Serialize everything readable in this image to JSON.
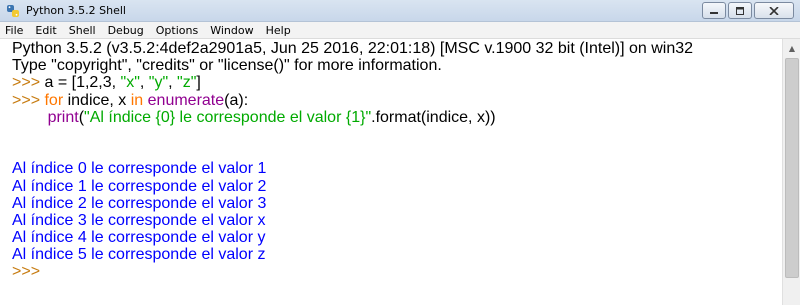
{
  "window": {
    "title": "Python 3.5.2 Shell",
    "icons": {
      "app": "python-icon",
      "minimize": "minimize-icon",
      "maximize": "maximize-icon",
      "close": "close-icon"
    }
  },
  "menu": [
    "File",
    "Edit",
    "Shell",
    "Debug",
    "Options",
    "Window",
    "Help"
  ],
  "shell": {
    "banner1": "Python 3.5.2 (v3.5.2:4def2a2901a5, Jun 25 2016, 22:01:18) [MSC v.1900 32 bit (Intel)] on win32",
    "banner2": "Type \"copyright\", \"credits\" or \"license()\" for more information.",
    "prompt": ">>> ",
    "cmd1": {
      "part1": "a = [1,2,3, ",
      "s1": "\"x\"",
      "sep1": ", ",
      "s2": "\"y\"",
      "sep2": ", ",
      "s3": "\"z\"",
      "end": "]"
    },
    "cmd2": {
      "kw_for": "for",
      "mid1": " indice, x ",
      "kw_in": "in",
      "sp": " ",
      "bi_enum": "enumerate",
      "end": "(a):"
    },
    "cmd3": {
      "indent": "        ",
      "bi_print": "print",
      "open": "(",
      "str": "\"Al índice {0} le corresponde el valor {1}\"",
      "end": ".format(indice, x))"
    },
    "output": [
      "Al índice 0 le corresponde el valor 1",
      "Al índice 1 le corresponde el valor 2",
      "Al índice 2 le corresponde el valor 3",
      "Al índice 3 le corresponde el valor x",
      "Al índice 4 le corresponde el valor y",
      "Al índice 5 le corresponde el valor z"
    ],
    "final_prompt": ">>> "
  },
  "colors": {
    "prompt": "#c77c11",
    "keyword": "#ff7700",
    "builtin": "#900090",
    "string": "#00aa00",
    "output": "#0000ff"
  }
}
